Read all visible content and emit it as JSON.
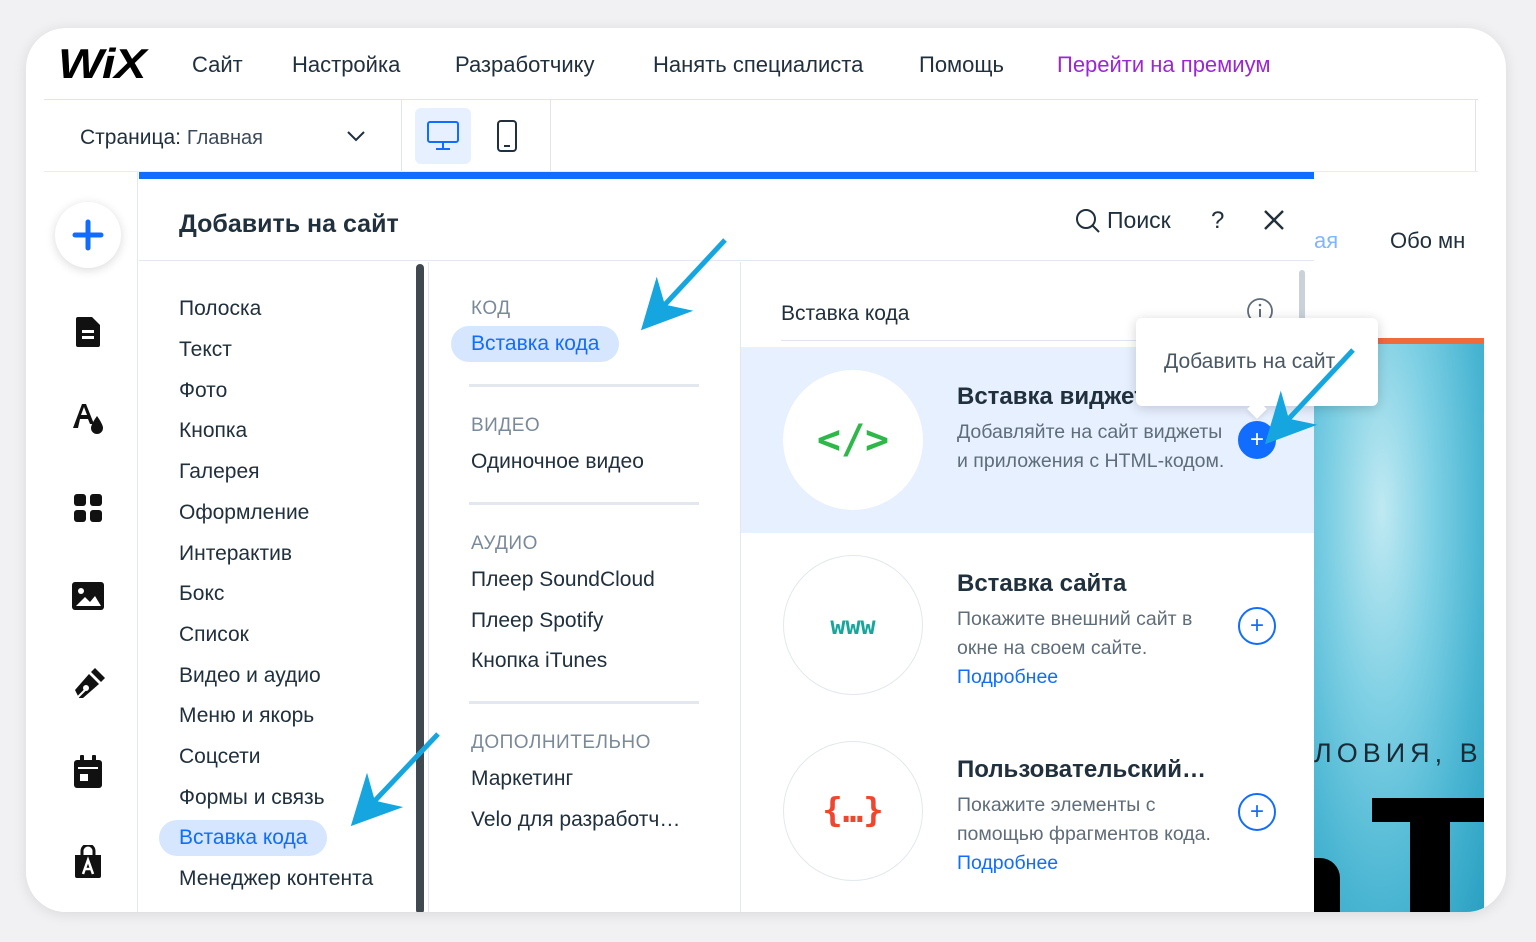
{
  "logo": "WiX",
  "top_menu": [
    "Сайт",
    "Настройка",
    "Разработчику",
    "Нанять специалиста",
    "Помощь"
  ],
  "premium_link": "Перейти на премиум",
  "page_selector": {
    "label": "Страница:",
    "value": "Главная"
  },
  "panel": {
    "title": "Добавить на сайт",
    "search": "Поиск",
    "help": "?",
    "categories": [
      "Полоска",
      "Текст",
      "Фото",
      "Кнопка",
      "Галерея",
      "Оформление",
      "Интерактив",
      "Бокс",
      "Список",
      "Видео и аудио",
      "Меню и якорь",
      "Соцсети",
      "Формы и связь",
      "Вставка кода",
      "Менеджер контента"
    ],
    "selected_category": "Вставка кода",
    "sections": [
      {
        "header": "КОД",
        "items": [
          "Вставка кода"
        ]
      },
      {
        "header": "ВИДЕО",
        "items": [
          "Одиночное видео"
        ]
      },
      {
        "header": "АУДИО",
        "items": [
          "Плеер SoundCloud",
          "Плеер Spotify",
          "Кнопка iTunes"
        ]
      },
      {
        "header": "ДОПОЛНИТЕЛЬНО",
        "items": [
          "Маркетинг",
          "Velo для разработч…"
        ]
      }
    ],
    "content_title": "Вставка кода",
    "widgets": [
      {
        "icon": "</>",
        "icon_color": "#2fb84a",
        "title": "Вставка виджета",
        "desc": "Добавляйте на сайт виджеты и приложения с HTML-кодом.",
        "link": ""
      },
      {
        "icon": "www",
        "icon_color": "#17a69b",
        "title": "Вставка сайта",
        "desc": "Покажите внешний сайт в окне на своем сайте.",
        "link": "Подробнее"
      },
      {
        "icon": "{…}",
        "icon_color": "#f0462d",
        "title": "Пользовательский…",
        "desc": "Покажите элементы с помощью фрагментов кода.",
        "link": "Подробнее"
      }
    ],
    "plus": "+"
  },
  "tooltip": "Добавить на сайт",
  "site_preview": {
    "nav_left": "ая",
    "nav_right": "Обо мн",
    "caption": "ЛОВИЯ, ВІ"
  },
  "colors": {
    "accent": "#116dff",
    "premium": "#9a27d5",
    "selected_bg": "#d6e6fe",
    "annotation_arrow": "#15a6df"
  }
}
